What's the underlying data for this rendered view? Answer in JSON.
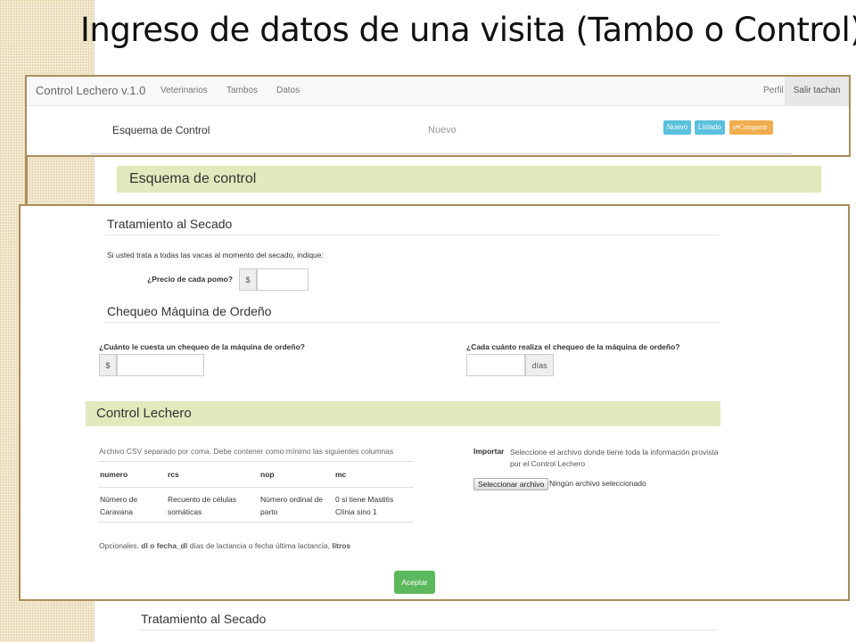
{
  "slide": {
    "title": "Ingreso de datos de una visita (Tambo o Control)"
  },
  "navbar": {
    "brand": "Control Lechero v.1.0",
    "links": [
      "Veterinarios",
      "Tambos",
      "Datos"
    ],
    "profile": "Perfil",
    "logout": "Salir tachan"
  },
  "header": {
    "title": "Esquema de Control",
    "state": "Nuevo",
    "buttons": {
      "nuevo": "Nuevo",
      "listado": "Listado",
      "comparar": "⇄Comparar"
    }
  },
  "section_esquema": {
    "title": "Esquema de control"
  },
  "secado": {
    "title": "Tratamiento al Secado",
    "intro": "Si usted trata a todas las vacas al momento del secado, indique:",
    "precio_label": "¿Precio de cada pomo?",
    "currency": "$"
  },
  "maquina": {
    "title": "Chequeo Máquina de Ordeño",
    "costo_label": "¿Cuánto le cuesta un chequeo de la máquina de ordeño?",
    "currency": "$",
    "frecuencia_label": "¿Cada cuánto realiza el chequeo de la máquina de ordeño?",
    "unit": "días"
  },
  "control": {
    "title": "Control Lechero",
    "csv_note": "Archivo CSV separado por coma. Debe contener como mínimo las siguientes columnas",
    "columns": [
      "numero",
      "rcs",
      "nop",
      "mc"
    ],
    "descriptions": [
      "Número de Caravana",
      "Recuento de células somáticas",
      "Número ordinal de parto",
      "0 si tiene Mastitis Clínia sino 1"
    ],
    "optional_prefix": "Opcionales.",
    "optional_dl": "dl o fecha_dl",
    "optional_mid": "días de lactancia o fecha última lactancia,",
    "optional_litros": "litros",
    "import_label": "Importar",
    "import_help": "Seleccione el archivo donde tiene toda la información provista por el Control Lechero",
    "file_button": "Seleccionar archivo",
    "file_status": "Ningún archivo seleccionado",
    "submit": "Aceptar"
  },
  "bottom": {
    "title": "Tratamiento al Secado"
  }
}
